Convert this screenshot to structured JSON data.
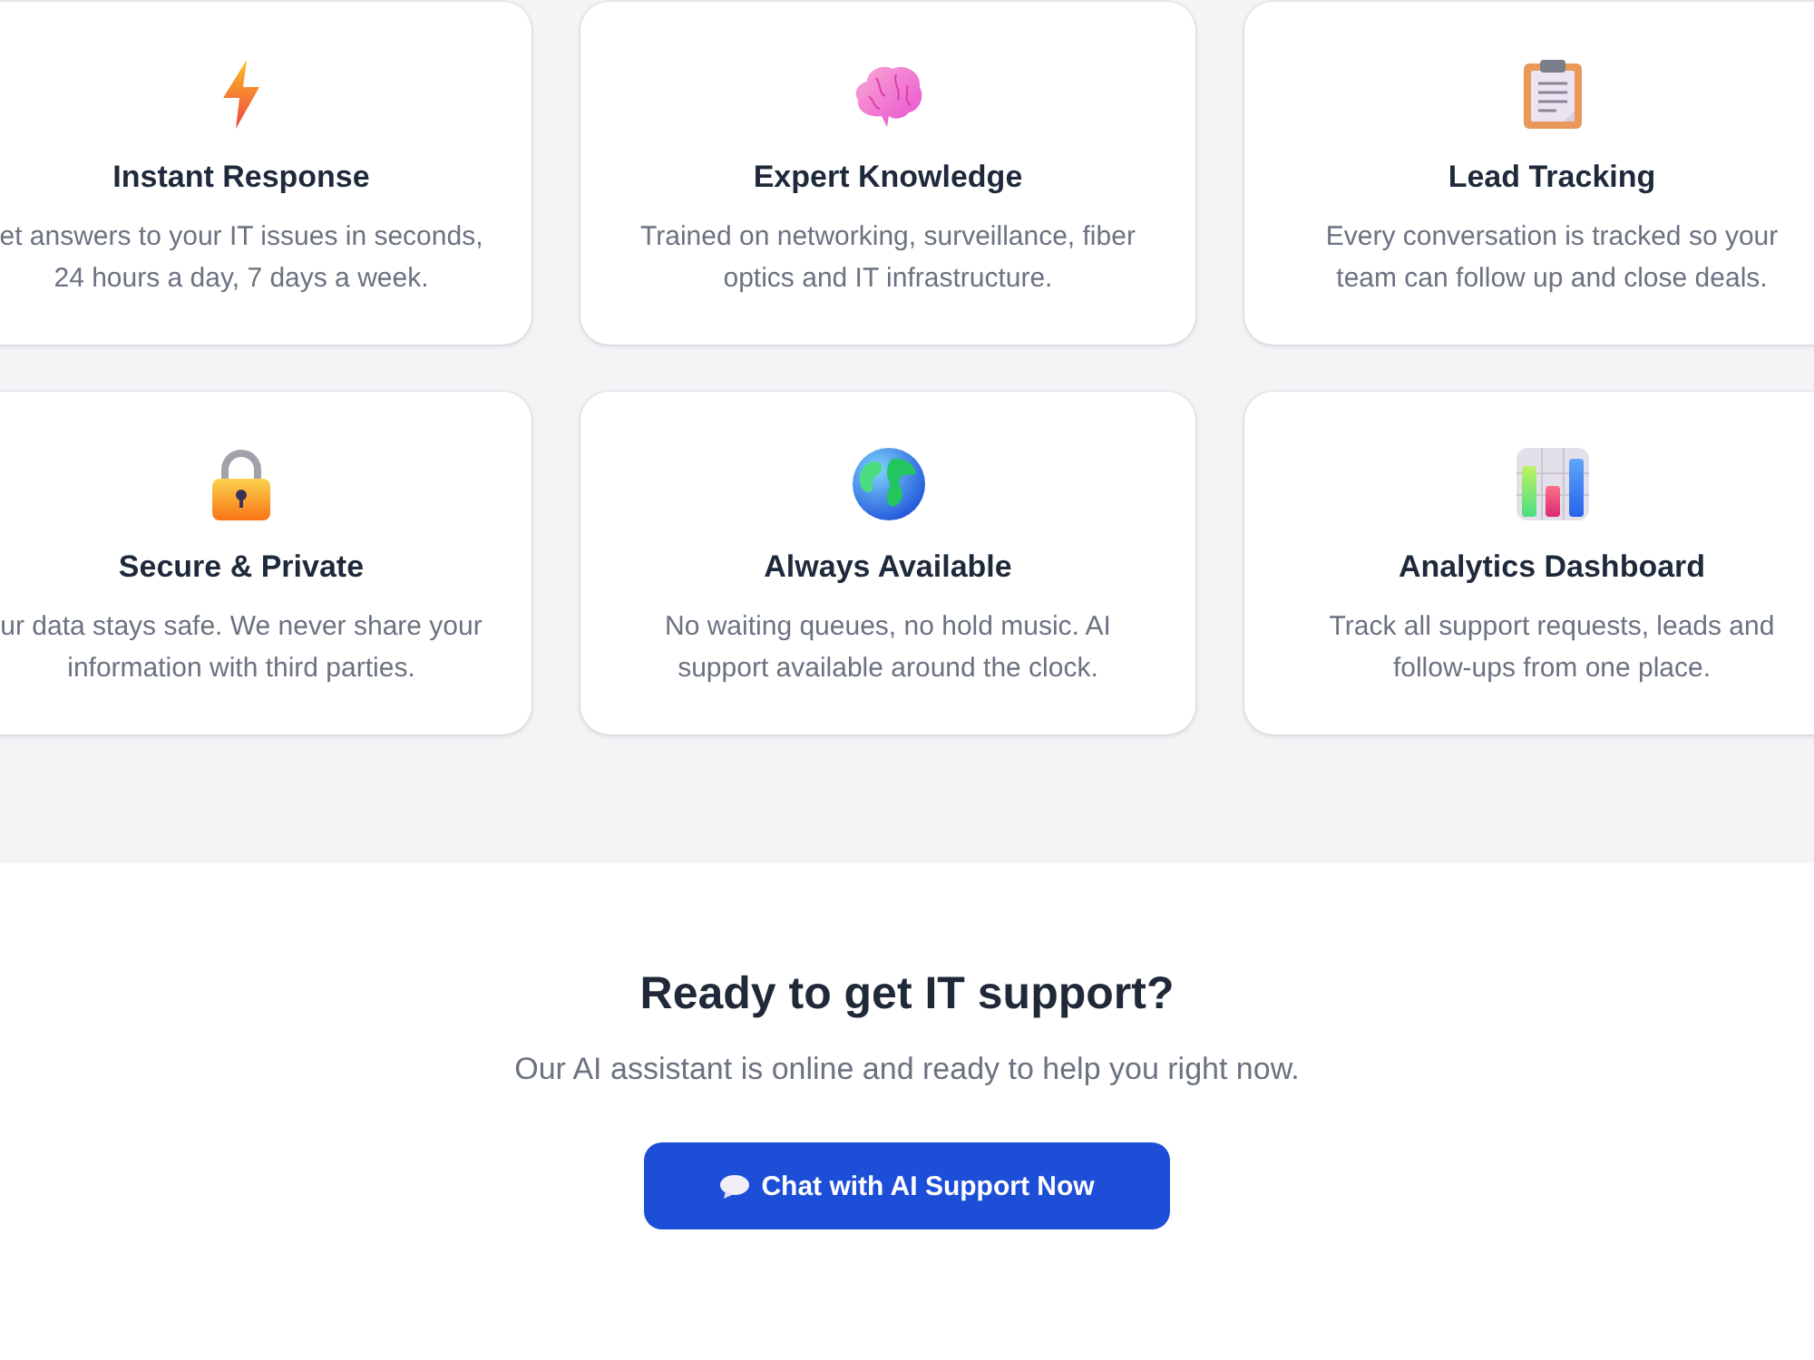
{
  "features": [
    {
      "kind": "bolt",
      "title": "Instant Response",
      "description": [
        "et answers to your IT issues in seconds,",
        "24 hours a day, 7 days a week."
      ]
    },
    {
      "kind": "brain",
      "title": "Expert Knowledge",
      "description": [
        "Trained on networking, surveillance, fiber",
        "optics and IT infrastructure."
      ]
    },
    {
      "kind": "clipboard",
      "title": "Lead Tracking",
      "description": [
        "Every conversation is tracked so your",
        "team can follow up and close deals."
      ]
    },
    {
      "kind": "lock",
      "title": "Secure & Private",
      "description": [
        "ur data stays safe. We never share your",
        "information with third parties."
      ]
    },
    {
      "kind": "globe",
      "title": "Always Available",
      "description": [
        "No waiting queues, no hold music. AI",
        "support available around the clock."
      ]
    },
    {
      "kind": "chart",
      "title": "Analytics Dashboard",
      "description": [
        "Track all support requests, leads and",
        "follow-ups from one place."
      ]
    }
  ],
  "cta": {
    "heading": "Ready to get IT support?",
    "subtitle": "Our AI assistant is online and ready to help you right now.",
    "button": "Chat with AI Support Now"
  }
}
